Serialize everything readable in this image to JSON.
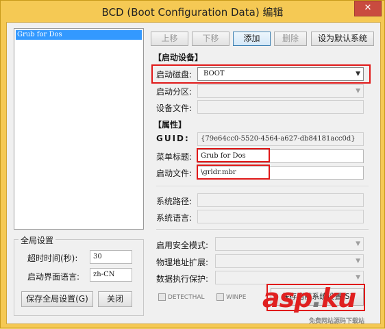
{
  "window": {
    "title": "BCD (Boot Configuration Data) 编辑",
    "close_glyph": "✕"
  },
  "boot_list": [
    "Grub for Dos"
  ],
  "toolbar": {
    "move_up": "上移",
    "move_down": "下移",
    "add": "添加",
    "delete": "删除",
    "set_default": "设为默认系统"
  },
  "boot_device": {
    "section_title": "【启动设备】",
    "disk_label": "启动磁盘:",
    "disk_value": "BOOT",
    "partition_label": "启动分区:",
    "device_file_label": "设备文件:"
  },
  "properties": {
    "section_title": "【属性】",
    "guid_label": "GUID:",
    "guid_value": "{79e64cc0-5520-4564-a627-db84181acc0d}",
    "menu_title_label": "菜单标题:",
    "menu_title_value": "Grub for Dos",
    "boot_file_label": "启动文件:",
    "boot_file_value": "\\grldr.mbr",
    "system_path_label": "系统路径:",
    "system_language_label": "系统语言:",
    "safe_mode_label": "启用安全模式:",
    "pae_label": "物理地址扩展:",
    "dep_label": "数据执行保护:",
    "detecthal_label": "DETECTHAL",
    "winpe_label": "WINPE",
    "save_current_label": "保存当前系统设置(S)"
  },
  "global_settings": {
    "group_title": "全局设置",
    "timeout_label": "超时时间(秒):",
    "timeout_value": "30",
    "ui_language_label": "启动界面语言:",
    "ui_language_value": "zh-CN",
    "save_global_label": "保存全局设置(G)",
    "close_label": "关闭"
  },
  "watermark": {
    "main_left": "asp",
    "main_dot": ".",
    "main_right": "ku",
    "sub": "免费网站源码下载站"
  }
}
